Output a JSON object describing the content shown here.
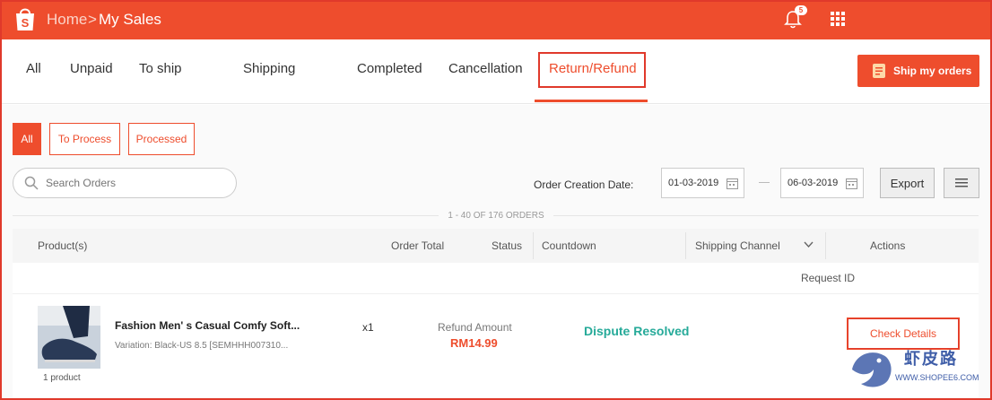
{
  "header": {
    "breadcrumb_home": "Home",
    "breadcrumb_sep": ">",
    "breadcrumb_current": "My Sales",
    "notification_count": "5",
    "accent_color": "#ee4d2d"
  },
  "tabs": {
    "items": [
      "All",
      "Unpaid",
      "To ship",
      "Shipping",
      "Completed",
      "Cancellation",
      "Return/Refund"
    ],
    "active": "Return/Refund",
    "ship_button": "Ship my orders"
  },
  "filters": {
    "sub_tabs": [
      "All",
      "To Process",
      "Processed"
    ],
    "active_sub_tab": "All",
    "search_placeholder": "Search Orders",
    "date_label": "Order Creation Date:",
    "date_from": "01-03-2019",
    "date_to": "06-03-2019",
    "export_label": "Export"
  },
  "orders": {
    "count_text": "1 - 40 OF 176 ORDERS",
    "columns": [
      "Product(s)",
      "Order Total",
      "Status",
      "Countdown",
      "Shipping Channel",
      "Actions"
    ],
    "request_id_label": "Request ID",
    "rows": [
      {
        "product_name": "Fashion Men' s Casual Comfy Soft...",
        "variation": "Variation: Black-US 8.5 [SEMHHH007310...",
        "product_count": "1 product",
        "quantity": "x1",
        "refund_label": "Refund Amount",
        "refund_amount": "RM14.99",
        "status": "Dispute Resolved",
        "action": "Check Details"
      }
    ]
  },
  "watermark": {
    "name": "虾皮路",
    "url": "WWW.SHOPEE6.COM"
  }
}
